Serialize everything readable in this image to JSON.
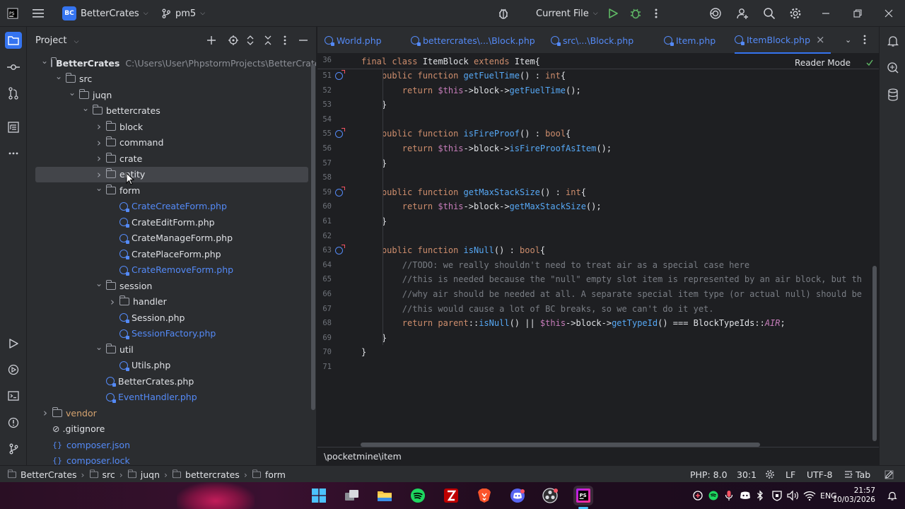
{
  "titlebar": {
    "project_badge": "BC",
    "project_name": "BetterCrates",
    "branch_name": "pm5",
    "run_config": "Current File"
  },
  "project_panel": {
    "title": "Project",
    "tree": [
      {
        "label": "BetterCrates",
        "hint": "C:\\Users\\User\\PhpstormProjects\\BetterCrates",
        "kind": "folder",
        "expanded": true
      },
      {
        "label": "src",
        "kind": "folder",
        "expanded": true
      },
      {
        "label": "juqn",
        "kind": "folder",
        "expanded": true
      },
      {
        "label": "bettercrates",
        "kind": "folder",
        "expanded": true
      },
      {
        "label": "block",
        "kind": "folder",
        "expanded": false
      },
      {
        "label": "command",
        "kind": "folder",
        "expanded": false
      },
      {
        "label": "crate",
        "kind": "folder",
        "expanded": false
      },
      {
        "label": "entity",
        "kind": "folder",
        "expanded": false,
        "selected": true
      },
      {
        "label": "form",
        "kind": "folder",
        "expanded": true
      },
      {
        "label": "CrateCreateForm.php",
        "kind": "php-blue"
      },
      {
        "label": "CrateEditForm.php",
        "kind": "php-plain"
      },
      {
        "label": "CrateManageForm.php",
        "kind": "php-plain"
      },
      {
        "label": "CratePlaceForm.php",
        "kind": "php-plain"
      },
      {
        "label": "CrateRemoveForm.php",
        "kind": "php-blue"
      },
      {
        "label": "session",
        "kind": "folder",
        "expanded": true
      },
      {
        "label": "handler",
        "kind": "folder",
        "expanded": false
      },
      {
        "label": "Session.php",
        "kind": "php-plain"
      },
      {
        "label": "SessionFactory.php",
        "kind": "php-blue"
      },
      {
        "label": "util",
        "kind": "folder",
        "expanded": true
      },
      {
        "label": "Utils.php",
        "kind": "php-plain"
      },
      {
        "label": "BetterCrates.php",
        "kind": "php-plain"
      },
      {
        "label": "EventHandler.php",
        "kind": "php-blue"
      },
      {
        "label": "vendor",
        "kind": "folder-dim",
        "expanded": false
      },
      {
        "label": ".gitignore",
        "kind": "ignore"
      },
      {
        "label": "composer.json",
        "kind": "json"
      },
      {
        "label": "composer.lock",
        "kind": "json"
      }
    ]
  },
  "tabs": [
    {
      "label": "World.php",
      "active": false
    },
    {
      "label": "bettercrates\\...\\Block.php",
      "active": false
    },
    {
      "label": "src\\...\\Block.php",
      "active": false
    },
    {
      "label": "Item.php",
      "active": false
    },
    {
      "label": "ItemBlock.php",
      "active": true
    }
  ],
  "editor": {
    "reader_mode": "Reader Mode",
    "sticky_line_number": "36",
    "sticky_header": "final class ItemBlock extends Item{",
    "footer_path": "\\pocketmine\\item"
  },
  "code_lines": [
    {
      "n": "51",
      "text": "    public function getFuelTime() : int{"
    },
    {
      "n": "52",
      "text": "        return $this->block->getFuelTime();"
    },
    {
      "n": "53",
      "text": "    }"
    },
    {
      "n": "54",
      "text": ""
    },
    {
      "n": "55",
      "text": "    public function isFireProof() : bool{"
    },
    {
      "n": "56",
      "text": "        return $this->block->isFireProofAsItem();"
    },
    {
      "n": "57",
      "text": "    }"
    },
    {
      "n": "58",
      "text": ""
    },
    {
      "n": "59",
      "text": "    public function getMaxStackSize() : int{"
    },
    {
      "n": "60",
      "text": "        return $this->block->getMaxStackSize();"
    },
    {
      "n": "61",
      "text": "    }"
    },
    {
      "n": "62",
      "text": ""
    },
    {
      "n": "63",
      "text": "    public function isNull() : bool{"
    },
    {
      "n": "64",
      "text": "        //TODO: we really shouldn't need to treat air as a special case here"
    },
    {
      "n": "65",
      "text": "        //this is needed because the \"null\" empty slot item is represented by an air block, but th"
    },
    {
      "n": "66",
      "text": "        //why air should be needed at all. A separate special item type (or actual null) should be"
    },
    {
      "n": "67",
      "text": "        //this would cause a lot of BC breaks, so we can't do it yet."
    },
    {
      "n": "68",
      "text": "        return parent::isNull() || $this->block->getTypeId() === BlockTypeIds::AIR;"
    },
    {
      "n": "69",
      "text": "    }"
    },
    {
      "n": "70",
      "text": "}"
    },
    {
      "n": "71",
      "text": ""
    }
  ],
  "statusbar": {
    "breadcrumbs": [
      "BetterCrates",
      "src",
      "juqn",
      "bettercrates",
      "form"
    ],
    "php_version": "PHP: 8.0",
    "position": "30:1",
    "line_ending": "LF",
    "encoding": "UTF-8",
    "indent": "Tab"
  },
  "taskbar": {
    "language": "ENG",
    "time": "21:57",
    "date": "10/03/2026"
  },
  "colors": {
    "accent": "#3574f0",
    "keyword": "#cf8e6d",
    "function": "#56a8f5",
    "variable": "#c77dbb",
    "comment": "#7a7e85"
  }
}
